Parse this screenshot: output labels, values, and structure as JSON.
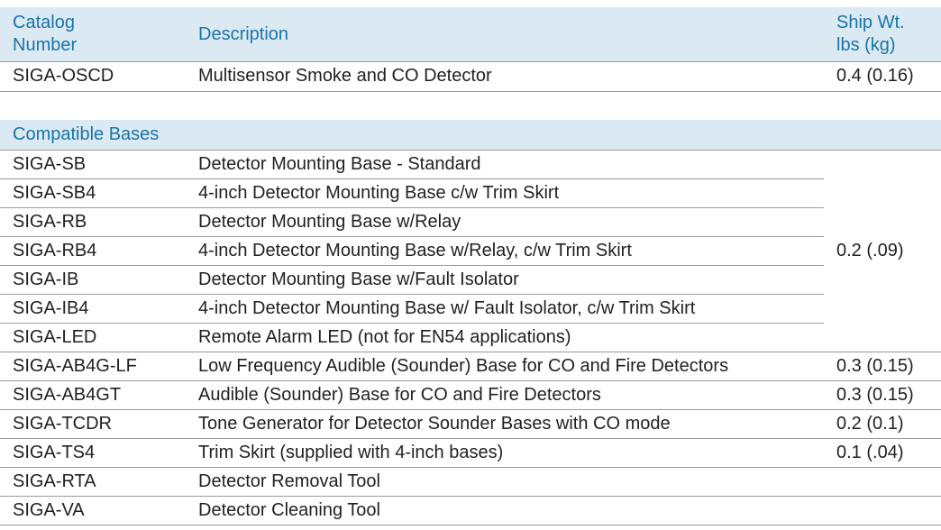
{
  "catalog_table": {
    "headers": [
      "Catalog\nNumber",
      "Description",
      "Ship Wt.\nlbs (kg)"
    ],
    "header_lines": {
      "catalog": [
        "Catalog",
        "Number"
      ],
      "description": "Description",
      "ship_wt": [
        "Ship Wt.",
        "lbs (kg)"
      ]
    },
    "rows": [
      {
        "catalog": "SIGA-OSCD",
        "description": "Multisensor Smoke and CO Detector",
        "weight": "0.4 (0.16)"
      }
    ]
  },
  "bases_table": {
    "section_title": "Compatible Bases",
    "merged_weight": "0.2 (.09)",
    "rows": [
      {
        "catalog": "SIGA-SB",
        "description": "Detector Mounting Base - Standard",
        "weight": ""
      },
      {
        "catalog": "SIGA-SB4",
        "description": "4-inch Detector Mounting Base c/w Trim Skirt",
        "weight": ""
      },
      {
        "catalog": "SIGA-RB",
        "description": "Detector Mounting Base w/Relay",
        "weight": ""
      },
      {
        "catalog": "SIGA-RB4",
        "description": "4-inch Detector Mounting Base w/Relay, c/w Trim Skirt",
        "weight": ""
      },
      {
        "catalog": "SIGA-IB",
        "description": "Detector Mounting Base w/Fault Isolator",
        "weight": ""
      },
      {
        "catalog": "SIGA-IB4",
        "description": "4-inch Detector Mounting Base w/ Fault Isolator, c/w Trim Skirt",
        "weight": ""
      },
      {
        "catalog": "SIGA-LED",
        "description": "Remote Alarm LED (not for EN54 applications)",
        "weight": ""
      },
      {
        "catalog": "SIGA-AB4G-LF",
        "description": "Low Frequency Audible (Sounder) Base for CO and Fire Detectors",
        "weight": "0.3 (0.15)"
      },
      {
        "catalog": "SIGA-AB4GT",
        "description": "Audible (Sounder) Base for CO and Fire Detectors",
        "weight": "0.3 (0.15)"
      },
      {
        "catalog": "SIGA-TCDR",
        "description": "Tone Generator for Detector Sounder Bases with CO mode",
        "weight": "0.2 (0.1)"
      },
      {
        "catalog": "SIGA-TS4",
        "description": "Trim Skirt (supplied with 4-inch bases)",
        "weight": "0.1 (.04)"
      },
      {
        "catalog": "SIGA-RTA",
        "description": "Detector Removal Tool",
        "weight": ""
      },
      {
        "catalog": "SIGA-VA",
        "description": "Detector Cleaning Tool",
        "weight": ""
      }
    ]
  },
  "colors": {
    "header_bg": "#dbe9f3",
    "header_text": "#1a74a8",
    "body_text": "#231f20",
    "rule": "#9a9a9a"
  }
}
